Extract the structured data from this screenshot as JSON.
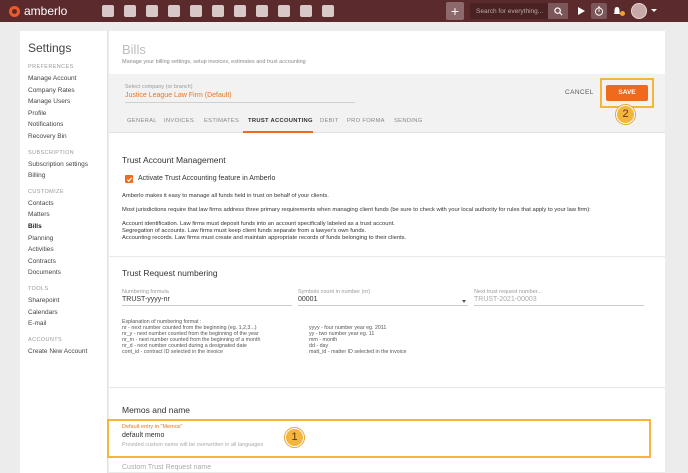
{
  "topbar": {
    "brand": "amberlo",
    "search_placeholder": "Search for everything...",
    "nav_icons": [
      "dashboard-icon",
      "contacts-icon",
      "briefcase-icon",
      "bills-icon",
      "bank-icon",
      "calendar-icon",
      "timer-icon",
      "folder-icon",
      "documents-icon",
      "mail-icon",
      "reports-icon"
    ],
    "colors": {
      "bar": "#5b2a2d",
      "accent": "#f06a1e"
    }
  },
  "sidebar": {
    "title": "Settings",
    "sections": [
      {
        "label": "PREFERENCES",
        "items": [
          "Manage Account",
          "Company Rates",
          "Manage Users",
          "Profile",
          "Notifications",
          "Recovery Bin"
        ]
      },
      {
        "label": "SUBSCRIPTION",
        "items": [
          "Subscription settings",
          "Billing"
        ]
      },
      {
        "label": "CUSTOMIZE",
        "items": [
          "Contacts",
          "Matters",
          "Bills",
          "Planning",
          "Activities",
          "Contracts",
          "Documents"
        ]
      },
      {
        "label": "TOOLS",
        "items": [
          "Sharepoint",
          "Calendars",
          "E-mail"
        ]
      },
      {
        "label": "ACCOUNTS",
        "items": [
          "Create New Account"
        ]
      }
    ],
    "active_item": "Bills"
  },
  "page": {
    "title": "Bills",
    "subtitle": "Manage your billing settings, setup invoices, estimates and trust accounting",
    "company_label": "Select company (or branch)",
    "company_value": "Justice League Law Firm (Default)",
    "cancel_label": "CANCEL",
    "save_label": "SAVE",
    "tabs": [
      "GENERAL",
      "INVOICES",
      "ESTIMATES",
      "TRUST ACCOUNTING",
      "DEBIT",
      "PRO FORMA",
      "SENDING"
    ],
    "active_tab": "TRUST ACCOUNTING"
  },
  "trust_mgmt": {
    "title": "Trust Account Management",
    "checkbox_label": "Activate Trust Accounting feature in Amberlo",
    "checked": true,
    "p1": "Amberlo makes it easy to manage all funds held in trust on behalf of your clients.",
    "p2": "Most jurisdictions require that law firms address three primary requirements when managing client funds (be sure to check with your local authority for rules that apply to your law firm):",
    "p3": [
      "Account identification. Law firms must deposit funds into an account specifically labeled as a trust account.",
      "Segregation of accounts. Law firms must keep client funds separate from a lawyer's own funds.",
      "Accounting records. Law firms must create and maintain appropriate records of funds belonging to their clients."
    ]
  },
  "numbering": {
    "title": "Trust Request numbering",
    "formula_label": "Numbering formula",
    "formula_value": "TRUST-yyyy-nr",
    "symbols_label": "Symbols count in number (nr)",
    "symbols_value": "00001",
    "next_label": "Next trust request number...",
    "next_value": "TRUST-2021-00003",
    "expl_title": "Explanation of numbering format :",
    "expl_left": [
      "nr - next number counted from the beginning (eg. 1,2,3...)",
      "nr_y - next number counted from the beginning of the year",
      "nr_m - next number counted from the beginning of a month",
      "nr_d - next number counted during a designated date",
      "cont_id - contract ID selected in the invoice"
    ],
    "expl_right": [
      "yyyy - four number year eg. 2011",
      "yy - two number year eg. 11",
      "mm - month",
      "dd - day",
      "matt_id - matter ID selected in the invoice"
    ]
  },
  "memos": {
    "title": "Memos and name",
    "default_label": "Default entry in \"Memos\"",
    "default_value": "default memo",
    "custom_placeholder": "Custom Trust Request name",
    "custom_hint": "Provided custom name will be overwritten in all languages"
  },
  "annotations": {
    "badge_1": "1",
    "badge_2": "2",
    "highlight_color": "#f3b53b"
  }
}
